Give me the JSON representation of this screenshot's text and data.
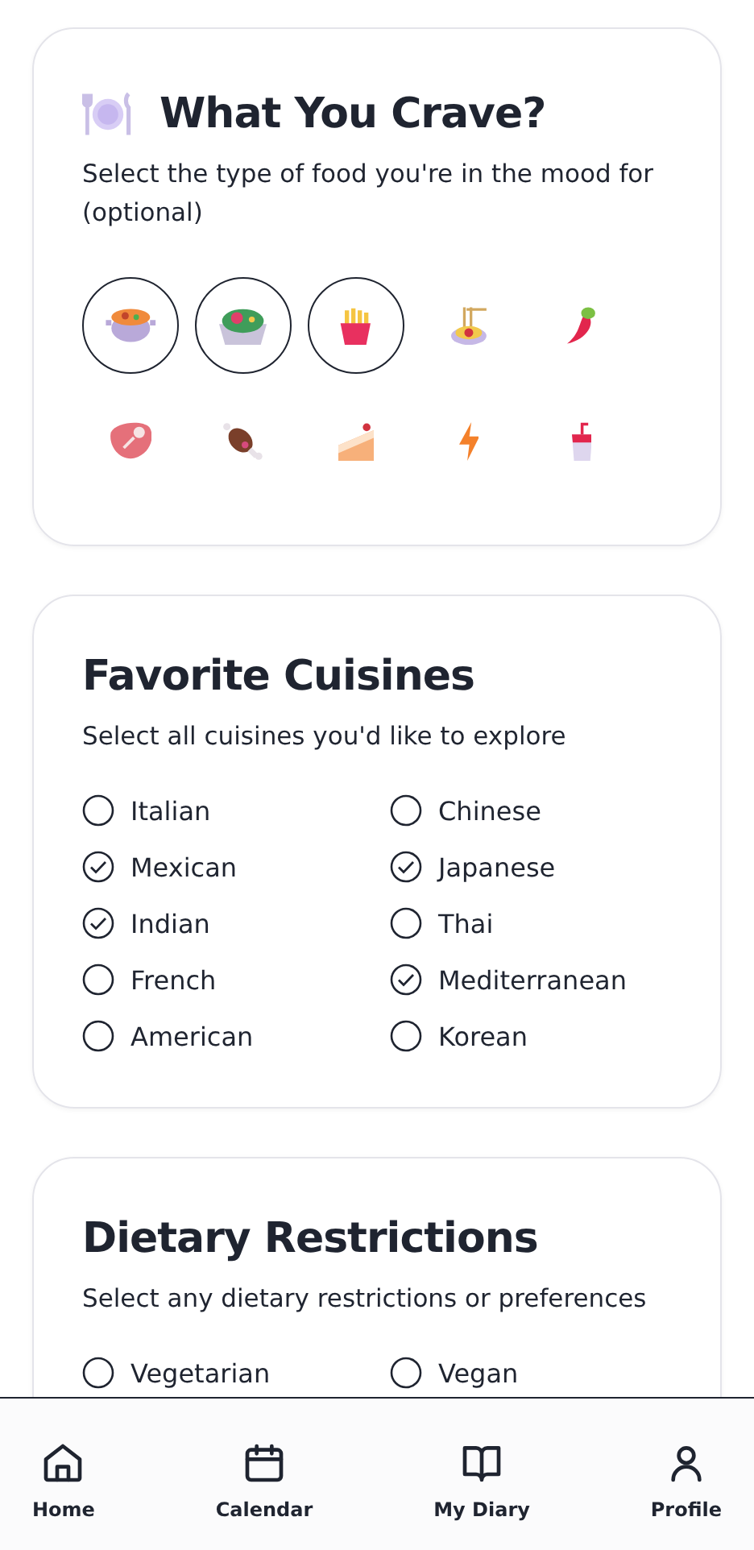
{
  "crave": {
    "title": "What You Crave?",
    "subtitle": "Select the type of food you're in the mood for (optional)",
    "foods": [
      {
        "kind": "stew",
        "selected": true
      },
      {
        "kind": "salad",
        "selected": true
      },
      {
        "kind": "fries",
        "selected": true
      },
      {
        "kind": "spaghetti",
        "selected": false
      },
      {
        "kind": "pepper",
        "selected": false
      },
      {
        "kind": "meat",
        "selected": false
      },
      {
        "kind": "drumstick",
        "selected": false
      },
      {
        "kind": "cake",
        "selected": false
      },
      {
        "kind": "bolt",
        "selected": false
      },
      {
        "kind": "drink",
        "selected": false
      }
    ]
  },
  "cuisines": {
    "title": "Favorite Cuisines",
    "subtitle": "Select all cuisines you'd like to explore",
    "options": [
      {
        "label": "Italian",
        "checked": false
      },
      {
        "label": "Chinese",
        "checked": false
      },
      {
        "label": "Mexican",
        "checked": true
      },
      {
        "label": "Japanese",
        "checked": true
      },
      {
        "label": "Indian",
        "checked": true
      },
      {
        "label": "Thai",
        "checked": false
      },
      {
        "label": "French",
        "checked": false
      },
      {
        "label": "Mediterranean",
        "checked": true
      },
      {
        "label": "American",
        "checked": false
      },
      {
        "label": "Korean",
        "checked": false
      }
    ]
  },
  "dietary": {
    "title": "Dietary Restrictions",
    "subtitle": "Select any dietary restrictions or preferences",
    "options": [
      {
        "label": "Vegetarian",
        "checked": false
      },
      {
        "label": "Vegan",
        "checked": false
      }
    ]
  },
  "nav": [
    {
      "label": "Home",
      "kind": "home"
    },
    {
      "label": "Calendar",
      "kind": "calendar"
    },
    {
      "label": "My Diary",
      "kind": "diary"
    },
    {
      "label": "Profile",
      "kind": "profile"
    }
  ]
}
